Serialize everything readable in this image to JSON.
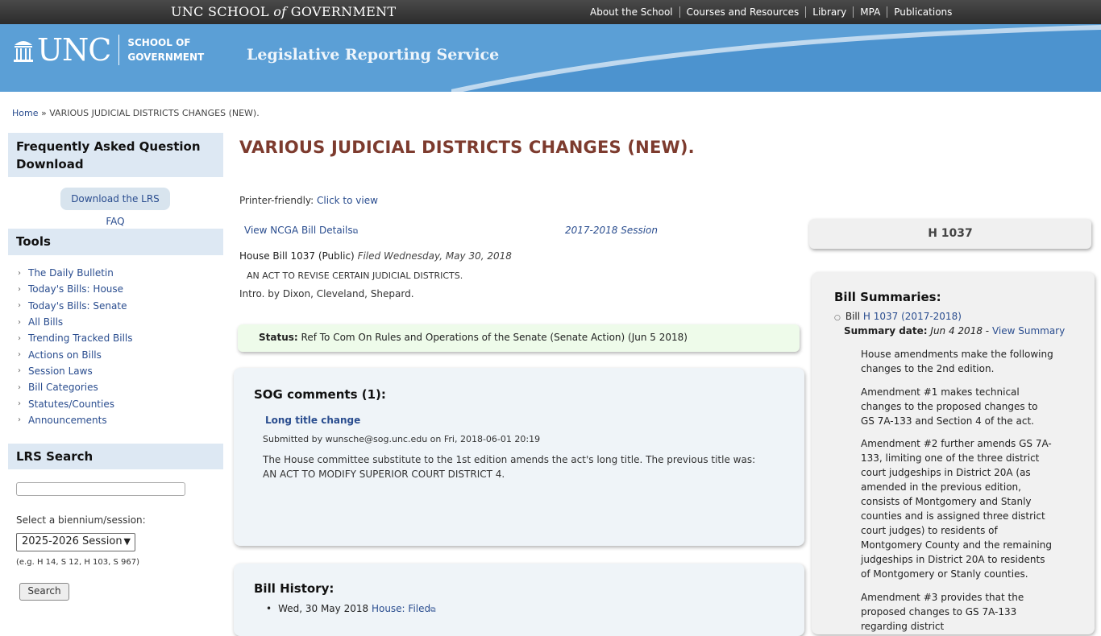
{
  "topbar": {
    "brand_pre": "UNC SCHOOL ",
    "brand_of": "of",
    "brand_post": " GOVERNMENT",
    "nav": [
      "About the School",
      "Courses and Resources",
      "Library",
      "MPA",
      "Publications"
    ]
  },
  "banner": {
    "logo_unc": "UNC",
    "logo_sog_line1": "SCHOOL OF",
    "logo_sog_line2": "GOVERNMENT",
    "service": "Legislative Reporting Service"
  },
  "breadcrumb": {
    "home": "Home",
    "sep": "»",
    "current": "VARIOUS JUDICIAL DISTRICTS CHANGES (NEW)."
  },
  "sidebar": {
    "faq_head": "Frequently Asked Question Download",
    "faq_button": "Download the LRS FAQ",
    "tools_head": "Tools",
    "tools": [
      "The Daily Bulletin",
      "Today's Bills: House",
      "Today's Bills: Senate",
      "All Bills",
      "Trending Tracked Bills",
      "Actions on Bills",
      "Session Laws",
      "Bill Categories",
      "Statutes/Counties",
      "Announcements"
    ],
    "search_head": "LRS Search",
    "select_label": "Select a biennium/session:",
    "selected_session": "2025-2026 Session",
    "example": "(e.g. H 14, S 12, H 103, S 967)",
    "search_button": "Search"
  },
  "main": {
    "title": "VARIOUS JUDICIAL DISTRICTS CHANGES (NEW).",
    "printer_label": "Printer-friendly:",
    "printer_link": "Click to view",
    "ncga_link": "View NCGA Bill Details",
    "session_link": "2017-2018 Session",
    "bill_name": "House Bill 1037",
    "bill_type": "(Public)",
    "filed": "Filed Wednesday, May 30, 2018",
    "act_title": "AN ACT TO REVISE CERTAIN JUDICIAL DISTRICTS.",
    "intro": "Intro. by Dixon, Cleveland, Shepard.",
    "status_label": "Status:",
    "status_text": "Ref To Com On Rules and Operations of the Senate (Senate Action) (Jun 5 2018)",
    "sog_head": "SOG comments (1):",
    "comment_title": "Long title change",
    "comment_submitted": "Submitted by wunsche@sog.unc.edu on Fri, 2018-06-01 20:19",
    "comment_text": "The House committee substitute to the 1st edition amends the act's long title. The previous title was: AN ACT TO MODIFY SUPERIOR COURT DISTRICT 4.",
    "history_head": "Bill History:",
    "history_date": "Wed, 30 May 2018",
    "history_link": "House: Filed"
  },
  "right": {
    "bill_number": "H 1037",
    "summaries_head": "Bill Summaries:",
    "bill_prefix": "Bill",
    "bill_link": "H 1037 (2017-2018)",
    "summary_date_label": "Summary date:",
    "summary_date": "Jun 4 2018",
    "summary_dash": " - ",
    "view_summary": "View Summary",
    "paragraphs": [
      "House amendments make the following changes to the 2nd edition.",
      "Amendment #1 makes technical changes to the proposed changes to GS 7A-133 and Section 4 of the act.",
      "Amendment #2 further amends GS 7A-133, limiting one of the three district court judgeships in District 20A (as amended in the previous edition, consists of Montgomery and Stanly counties and is assigned three district court judges) to residents of Montgomery County and the remaining judgeships in District 20A to residents of Montgomery or Stanly counties.",
      "Amendment #3 provides that the proposed changes to GS 7A-133 regarding district"
    ]
  }
}
